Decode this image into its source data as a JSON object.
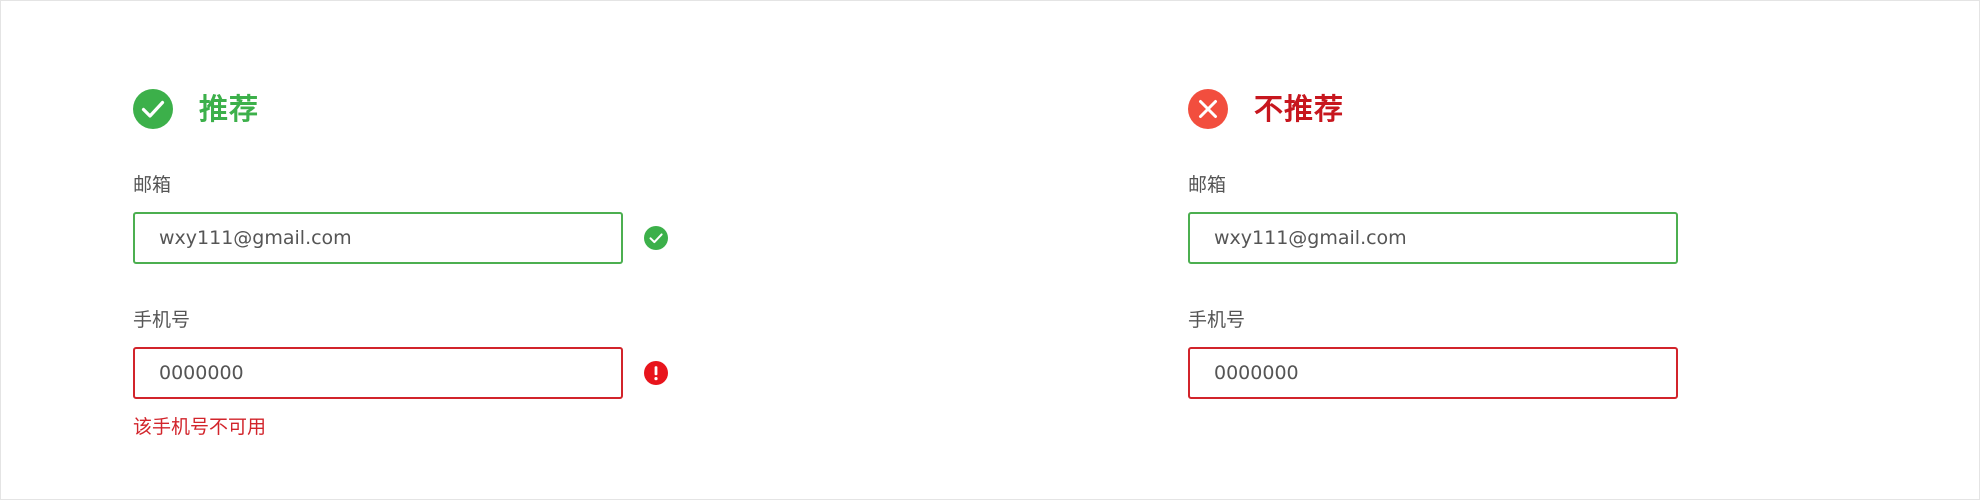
{
  "colors": {
    "recommend": "#3cb04a",
    "not_recommend": "#f24e3e",
    "input_ok_border": "#4caf50",
    "input_error_border": "#d2242b",
    "error_text": "#d2242b"
  },
  "recommended": {
    "icon": "check-circle-icon",
    "title": "推荐",
    "email": {
      "label": "邮箱",
      "value": "wxy111@gmail.com",
      "status_icon": "success-check-icon"
    },
    "phone": {
      "label": "手机号",
      "value": "0000000",
      "status_icon": "error-exclamation-icon",
      "error_message": "该手机号不可用"
    }
  },
  "not_recommended": {
    "icon": "x-circle-icon",
    "title": "不推荐",
    "email": {
      "label": "邮箱",
      "value": "wxy111@gmail.com"
    },
    "phone": {
      "label": "手机号",
      "value": "0000000"
    }
  }
}
